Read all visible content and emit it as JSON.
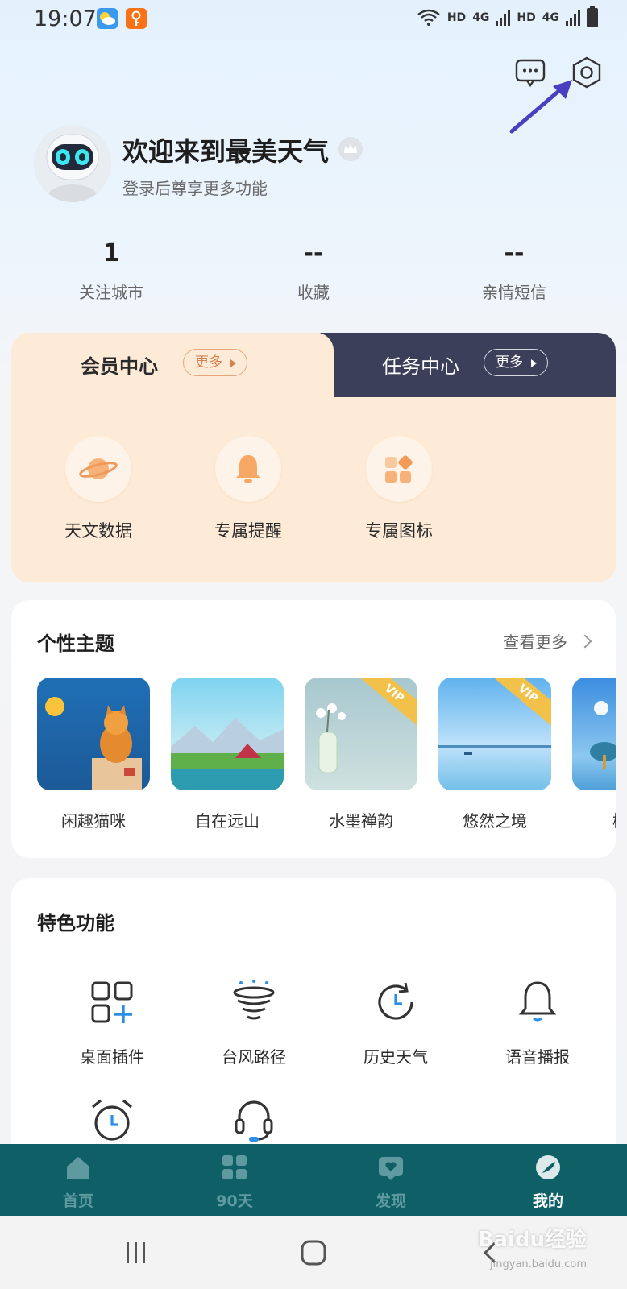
{
  "status_bar": {
    "time": "19:07",
    "network_label_1": "HD",
    "network_gen_1": "4G",
    "network_label_2": "HD",
    "network_gen_2": "4G"
  },
  "header": {
    "message_icon": "message-icon",
    "settings_icon": "settings-hexagon-icon"
  },
  "profile": {
    "title": "欢迎来到最美天气",
    "subtitle": "登录后尊享更多功能"
  },
  "stats": [
    {
      "value": "1",
      "label": "关注城市"
    },
    {
      "value": "--",
      "label": "收藏"
    },
    {
      "value": "--",
      "label": "亲情短信"
    }
  ],
  "member_center": {
    "tab_left": "会员中心",
    "tab_left_more": "更多",
    "tab_right": "任务中心",
    "tab_right_more": "更多",
    "items": [
      {
        "label": "天文数据",
        "icon": "planet-icon"
      },
      {
        "label": "专属提醒",
        "icon": "bell-icon"
      },
      {
        "label": "专属图标",
        "icon": "app-grid-icon"
      }
    ]
  },
  "themes": {
    "title": "个性主题",
    "see_more": "查看更多",
    "vip_badge": "VIP",
    "items": [
      {
        "label": "闲趣猫咪",
        "vip": false
      },
      {
        "label": "自在远山",
        "vip": false
      },
      {
        "label": "水墨禅韵",
        "vip": true
      },
      {
        "label": "悠然之境",
        "vip": true
      },
      {
        "label": "树田",
        "vip": false
      }
    ]
  },
  "features": {
    "title": "特色功能",
    "items": [
      {
        "label": "桌面插件",
        "icon": "widget-add-icon"
      },
      {
        "label": "台风路径",
        "icon": "typhoon-icon"
      },
      {
        "label": "历史天气",
        "icon": "history-clock-icon"
      },
      {
        "label": "语音播报",
        "icon": "voice-bell-icon"
      },
      {
        "label": "",
        "icon": "alarm-clock-icon"
      },
      {
        "label": "",
        "icon": "headset-icon"
      }
    ]
  },
  "bottom_nav": {
    "items": [
      {
        "label": "首页",
        "icon": "home-icon",
        "active": false
      },
      {
        "label": "90天",
        "icon": "grid-icon",
        "active": false
      },
      {
        "label": "发现",
        "icon": "discover-icon",
        "active": false
      },
      {
        "label": "我的",
        "icon": "profile-icon",
        "active": true
      }
    ]
  },
  "watermark": {
    "text": "Baidu经验",
    "sub": "jingyan.baidu.com"
  },
  "colors": {
    "nav_bg": "#0f5f67",
    "member_bg": "#fdebd7",
    "task_tab_bg": "#3c3f5a",
    "annotation_arrow": "#4a3fc1",
    "accent_blue": "#2b8fe6"
  }
}
